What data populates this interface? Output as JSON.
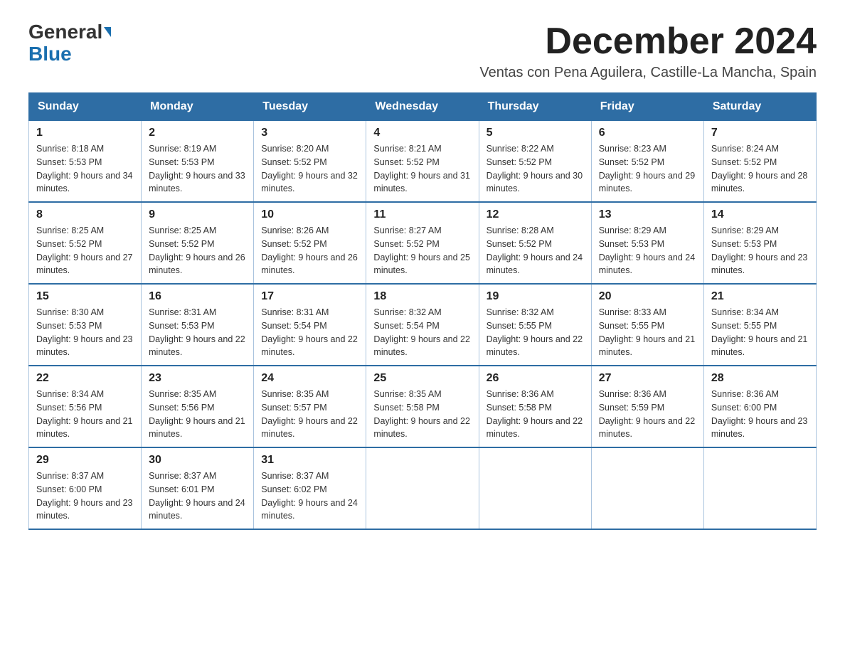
{
  "logo": {
    "text_general": "General",
    "text_blue": "Blue"
  },
  "header": {
    "month_year": "December 2024",
    "location": "Ventas con Pena Aguilera, Castille-La Mancha, Spain"
  },
  "weekdays": [
    "Sunday",
    "Monday",
    "Tuesday",
    "Wednesday",
    "Thursday",
    "Friday",
    "Saturday"
  ],
  "weeks": [
    [
      {
        "day": "1",
        "sunrise": "Sunrise: 8:18 AM",
        "sunset": "Sunset: 5:53 PM",
        "daylight": "Daylight: 9 hours and 34 minutes."
      },
      {
        "day": "2",
        "sunrise": "Sunrise: 8:19 AM",
        "sunset": "Sunset: 5:53 PM",
        "daylight": "Daylight: 9 hours and 33 minutes."
      },
      {
        "day": "3",
        "sunrise": "Sunrise: 8:20 AM",
        "sunset": "Sunset: 5:52 PM",
        "daylight": "Daylight: 9 hours and 32 minutes."
      },
      {
        "day": "4",
        "sunrise": "Sunrise: 8:21 AM",
        "sunset": "Sunset: 5:52 PM",
        "daylight": "Daylight: 9 hours and 31 minutes."
      },
      {
        "day": "5",
        "sunrise": "Sunrise: 8:22 AM",
        "sunset": "Sunset: 5:52 PM",
        "daylight": "Daylight: 9 hours and 30 minutes."
      },
      {
        "day": "6",
        "sunrise": "Sunrise: 8:23 AM",
        "sunset": "Sunset: 5:52 PM",
        "daylight": "Daylight: 9 hours and 29 minutes."
      },
      {
        "day": "7",
        "sunrise": "Sunrise: 8:24 AM",
        "sunset": "Sunset: 5:52 PM",
        "daylight": "Daylight: 9 hours and 28 minutes."
      }
    ],
    [
      {
        "day": "8",
        "sunrise": "Sunrise: 8:25 AM",
        "sunset": "Sunset: 5:52 PM",
        "daylight": "Daylight: 9 hours and 27 minutes."
      },
      {
        "day": "9",
        "sunrise": "Sunrise: 8:25 AM",
        "sunset": "Sunset: 5:52 PM",
        "daylight": "Daylight: 9 hours and 26 minutes."
      },
      {
        "day": "10",
        "sunrise": "Sunrise: 8:26 AM",
        "sunset": "Sunset: 5:52 PM",
        "daylight": "Daylight: 9 hours and 26 minutes."
      },
      {
        "day": "11",
        "sunrise": "Sunrise: 8:27 AM",
        "sunset": "Sunset: 5:52 PM",
        "daylight": "Daylight: 9 hours and 25 minutes."
      },
      {
        "day": "12",
        "sunrise": "Sunrise: 8:28 AM",
        "sunset": "Sunset: 5:52 PM",
        "daylight": "Daylight: 9 hours and 24 minutes."
      },
      {
        "day": "13",
        "sunrise": "Sunrise: 8:29 AM",
        "sunset": "Sunset: 5:53 PM",
        "daylight": "Daylight: 9 hours and 24 minutes."
      },
      {
        "day": "14",
        "sunrise": "Sunrise: 8:29 AM",
        "sunset": "Sunset: 5:53 PM",
        "daylight": "Daylight: 9 hours and 23 minutes."
      }
    ],
    [
      {
        "day": "15",
        "sunrise": "Sunrise: 8:30 AM",
        "sunset": "Sunset: 5:53 PM",
        "daylight": "Daylight: 9 hours and 23 minutes."
      },
      {
        "day": "16",
        "sunrise": "Sunrise: 8:31 AM",
        "sunset": "Sunset: 5:53 PM",
        "daylight": "Daylight: 9 hours and 22 minutes."
      },
      {
        "day": "17",
        "sunrise": "Sunrise: 8:31 AM",
        "sunset": "Sunset: 5:54 PM",
        "daylight": "Daylight: 9 hours and 22 minutes."
      },
      {
        "day": "18",
        "sunrise": "Sunrise: 8:32 AM",
        "sunset": "Sunset: 5:54 PM",
        "daylight": "Daylight: 9 hours and 22 minutes."
      },
      {
        "day": "19",
        "sunrise": "Sunrise: 8:32 AM",
        "sunset": "Sunset: 5:55 PM",
        "daylight": "Daylight: 9 hours and 22 minutes."
      },
      {
        "day": "20",
        "sunrise": "Sunrise: 8:33 AM",
        "sunset": "Sunset: 5:55 PM",
        "daylight": "Daylight: 9 hours and 21 minutes."
      },
      {
        "day": "21",
        "sunrise": "Sunrise: 8:34 AM",
        "sunset": "Sunset: 5:55 PM",
        "daylight": "Daylight: 9 hours and 21 minutes."
      }
    ],
    [
      {
        "day": "22",
        "sunrise": "Sunrise: 8:34 AM",
        "sunset": "Sunset: 5:56 PM",
        "daylight": "Daylight: 9 hours and 21 minutes."
      },
      {
        "day": "23",
        "sunrise": "Sunrise: 8:35 AM",
        "sunset": "Sunset: 5:56 PM",
        "daylight": "Daylight: 9 hours and 21 minutes."
      },
      {
        "day": "24",
        "sunrise": "Sunrise: 8:35 AM",
        "sunset": "Sunset: 5:57 PM",
        "daylight": "Daylight: 9 hours and 22 minutes."
      },
      {
        "day": "25",
        "sunrise": "Sunrise: 8:35 AM",
        "sunset": "Sunset: 5:58 PM",
        "daylight": "Daylight: 9 hours and 22 minutes."
      },
      {
        "day": "26",
        "sunrise": "Sunrise: 8:36 AM",
        "sunset": "Sunset: 5:58 PM",
        "daylight": "Daylight: 9 hours and 22 minutes."
      },
      {
        "day": "27",
        "sunrise": "Sunrise: 8:36 AM",
        "sunset": "Sunset: 5:59 PM",
        "daylight": "Daylight: 9 hours and 22 minutes."
      },
      {
        "day": "28",
        "sunrise": "Sunrise: 8:36 AM",
        "sunset": "Sunset: 6:00 PM",
        "daylight": "Daylight: 9 hours and 23 minutes."
      }
    ],
    [
      {
        "day": "29",
        "sunrise": "Sunrise: 8:37 AM",
        "sunset": "Sunset: 6:00 PM",
        "daylight": "Daylight: 9 hours and 23 minutes."
      },
      {
        "day": "30",
        "sunrise": "Sunrise: 8:37 AM",
        "sunset": "Sunset: 6:01 PM",
        "daylight": "Daylight: 9 hours and 24 minutes."
      },
      {
        "day": "31",
        "sunrise": "Sunrise: 8:37 AM",
        "sunset": "Sunset: 6:02 PM",
        "daylight": "Daylight: 9 hours and 24 minutes."
      },
      null,
      null,
      null,
      null
    ]
  ]
}
